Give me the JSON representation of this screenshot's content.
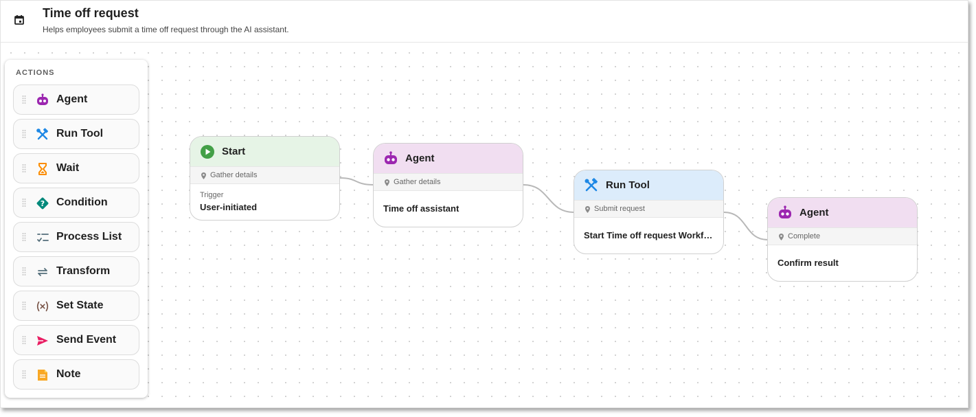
{
  "header": {
    "title": "Time off request",
    "subtitle": "Helps employees submit a time off request through the AI assistant.",
    "icon": "calendar-icon"
  },
  "palette": {
    "title": "ACTIONS",
    "items": [
      {
        "label": "Agent",
        "icon": "robot-icon",
        "color": "#9c27b0"
      },
      {
        "label": "Run Tool",
        "icon": "tools-icon",
        "color": "#1e88e5"
      },
      {
        "label": "Wait",
        "icon": "hourglass-icon",
        "color": "#fb8c00"
      },
      {
        "label": "Condition",
        "icon": "diamond-question-icon",
        "color": "#00897b"
      },
      {
        "label": "Process List",
        "icon": "checklist-icon",
        "color": "#546e7a"
      },
      {
        "label": "Transform",
        "icon": "swap-arrows-icon",
        "color": "#546e7a"
      },
      {
        "label": "Set State",
        "icon": "variable-icon",
        "color": "#795548"
      },
      {
        "label": "Send Event",
        "icon": "send-icon",
        "color": "#e91e63"
      },
      {
        "label": "Note",
        "icon": "note-icon",
        "color": "#f9a825"
      }
    ]
  },
  "nodes": [
    {
      "title": "Start",
      "subtitle": "Gather details",
      "meta": "Trigger",
      "value": "User-initiated",
      "icon": "play-circle-icon",
      "header_color": "#e6f4e6",
      "icon_color": "#43a047"
    },
    {
      "title": "Agent",
      "subtitle": "Gather details",
      "value": "Time off assistant",
      "icon": "robot-icon",
      "header_color": "#f1def1",
      "icon_color": "#9c27b0"
    },
    {
      "title": "Run Tool",
      "subtitle": "Submit request",
      "value": "Start Time off request Workf…",
      "icon": "tools-icon",
      "header_color": "#dcecfb",
      "icon_color": "#1e88e5"
    },
    {
      "title": "Agent",
      "subtitle": "Complete",
      "value": "Confirm result",
      "icon": "robot-icon",
      "header_color": "#f1def1",
      "icon_color": "#9c27b0"
    }
  ]
}
